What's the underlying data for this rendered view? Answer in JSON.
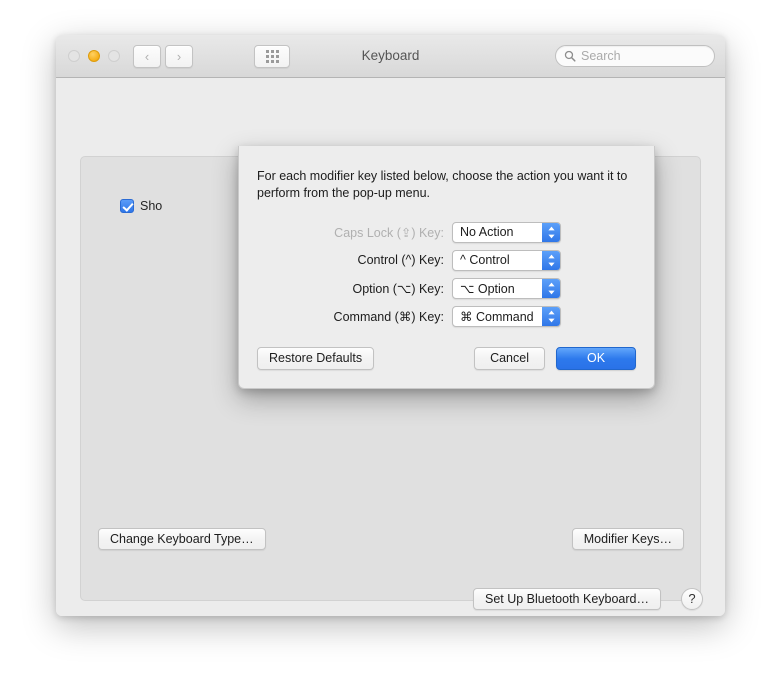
{
  "window": {
    "title": "Keyboard",
    "traffic_lights": [
      "close",
      "minimize",
      "zoom"
    ],
    "nav": {
      "back": "‹",
      "forward": "›"
    },
    "grid_button": "show-all-preferences",
    "search": {
      "placeholder": "Search",
      "value": ""
    }
  },
  "panel": {
    "checkbox": {
      "label": "Sho",
      "checked": true
    },
    "buttons": {
      "change_keyboard_type": "Change Keyboard Type…",
      "modifier_keys": "Modifier Keys…"
    }
  },
  "footer": {
    "setup_bluetooth": "Set Up Bluetooth Keyboard…",
    "help": "?"
  },
  "sheet": {
    "description": "For each modifier key listed below, choose the action you want it to perform from the pop-up menu.",
    "rows": [
      {
        "label": "Caps Lock (⇪) Key:",
        "value": "No Action",
        "disabled": true
      },
      {
        "label": "Control (^) Key:",
        "value": "^ Control",
        "disabled": false
      },
      {
        "label": "Option (⌥) Key:",
        "value": "⌥ Option",
        "disabled": false
      },
      {
        "label": "Command (⌘) Key:",
        "value": "⌘ Command",
        "disabled": false
      }
    ],
    "buttons": {
      "restore_defaults": "Restore Defaults",
      "cancel": "Cancel",
      "ok": "OK"
    }
  },
  "colors": {
    "accent_blue": "#2f76e8",
    "window_bg": "#ececec",
    "panel_bg": "#e0e0e0",
    "sheet_bg": "#ededed",
    "minimize_yellow": "#f5ab11"
  }
}
